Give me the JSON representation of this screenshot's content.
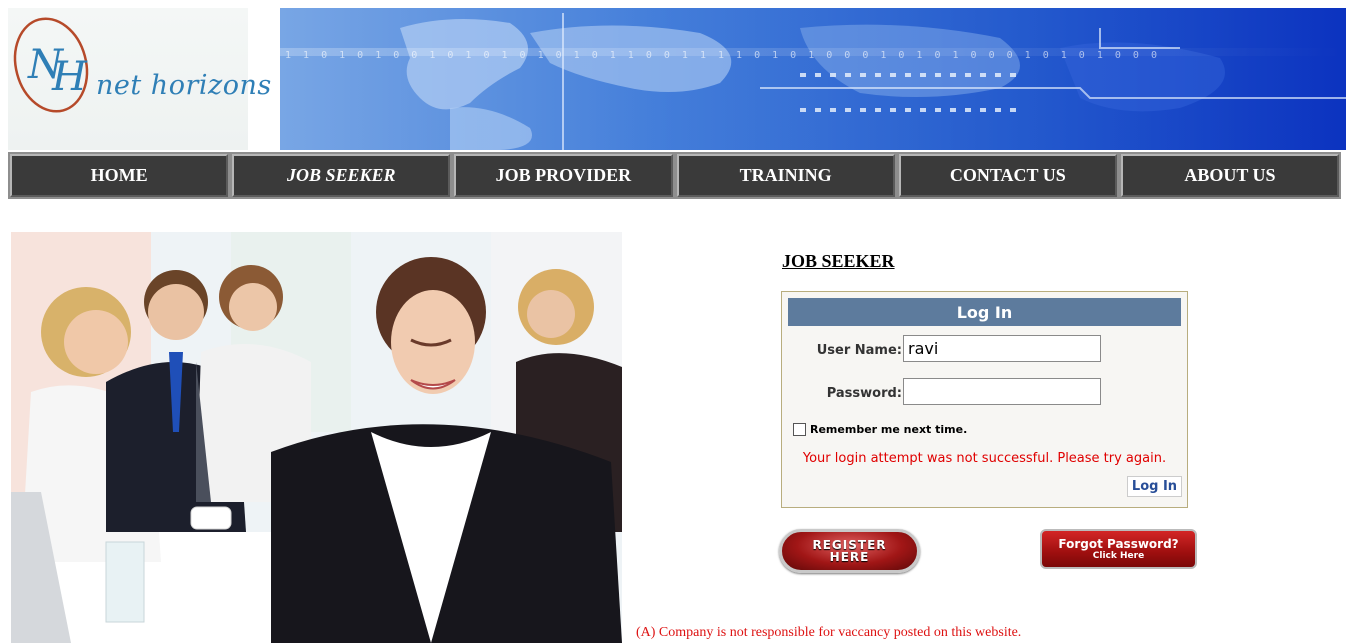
{
  "logo": {
    "monogram": "NH",
    "text": "net horizons"
  },
  "nav": {
    "items": [
      {
        "label": "HOME"
      },
      {
        "label": "JOB SEEKER"
      },
      {
        "label": "JOB PROVIDER"
      },
      {
        "label": "TRAINING"
      },
      {
        "label": "CONTACT US"
      },
      {
        "label": "ABOUT US"
      }
    ],
    "active": "JOB SEEKER"
  },
  "section_title": "JOB SEEKER",
  "login": {
    "header": "Log In",
    "username_label": "User Name:",
    "username_value": "ravi",
    "password_label": "Password:",
    "password_value": "",
    "remember_label": "Remember me next time.",
    "remember_checked": false,
    "error": "Your login attempt was not successful. Please try again.",
    "button": "Log In"
  },
  "register_button": {
    "line1": "REGISTER",
    "line2": "HERE"
  },
  "forgot_button": {
    "title": "Forgot Password?",
    "subtitle": "Click Here"
  },
  "disclaimer": "(A) Company is not responsible for vaccancy posted on this website.",
  "colors": {
    "nav_bg": "#3a3a3a",
    "login_header": "#5d7b9d",
    "error": "#e00000",
    "banner_blue": "#1f56cc"
  }
}
